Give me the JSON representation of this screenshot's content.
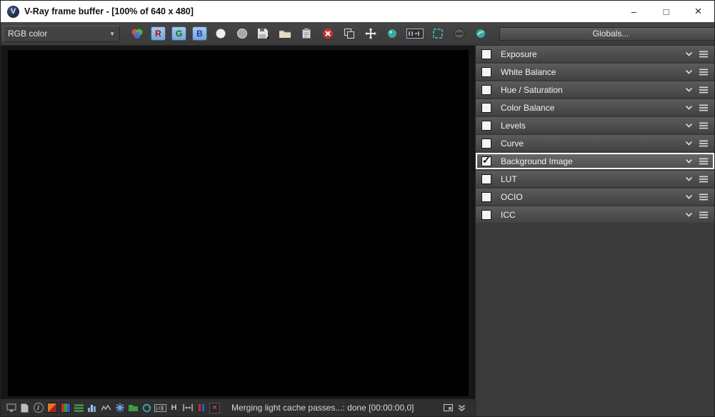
{
  "window": {
    "title": "V-Ray frame buffer - [100% of 640 x 480]",
    "logo_letter": "V",
    "controls": {
      "minimize": "–",
      "maximize": "□",
      "close": "×"
    }
  },
  "toolbar": {
    "channel_select_value": "RGB color",
    "channel_buttons": {
      "r": "R",
      "g": "G",
      "b": "B"
    },
    "globals_label": "Globals...",
    "icons": [
      "color-channels-icon",
      "red-channel-button",
      "green-channel-button",
      "blue-channel-button",
      "monochrome-channel-icon",
      "alpha-channel-icon",
      "save-image-icon",
      "load-image-icon",
      "copy-clipboard-icon",
      "clear-image-icon",
      "duplicate-window-icon",
      "track-mouse-icon",
      "render-last-icon",
      "stamp-icon",
      "region-render-icon",
      "stop-render-icon",
      "lens-effects-icon"
    ]
  },
  "panel": {
    "rows": [
      {
        "label": "Exposure",
        "checked": false,
        "highlighted": false
      },
      {
        "label": "White Balance",
        "checked": false,
        "highlighted": false
      },
      {
        "label": "Hue / Saturation",
        "checked": false,
        "highlighted": false
      },
      {
        "label": "Color Balance",
        "checked": false,
        "highlighted": false
      },
      {
        "label": "Levels",
        "checked": false,
        "highlighted": false
      },
      {
        "label": "Curve",
        "checked": false,
        "highlighted": false
      },
      {
        "label": "Background Image",
        "checked": true,
        "highlighted": true
      },
      {
        "label": "LUT",
        "checked": false,
        "highlighted": false
      },
      {
        "label": "OCIO",
        "checked": false,
        "highlighted": false
      },
      {
        "label": "ICC",
        "checked": false,
        "highlighted": false
      }
    ]
  },
  "statusbar": {
    "message": "Merging light cache passes...: done [00:00:00,0]",
    "icons": [
      "monitor-icon",
      "document-icon",
      "info-icon",
      "color-sample-icon",
      "rgb-pixels-icon",
      "list-icon",
      "histogram-icon",
      "waveform-icon",
      "asterisk-icon",
      "folder-icon",
      "refresh-icon",
      "lcd-icon",
      "letter-h-icon",
      "fit-width-icon",
      "compare-bars-icon",
      "close-stats-icon",
      "frame-outline-icon",
      "collapse-chevrons-icon"
    ]
  },
  "colors": {
    "channel_button_bg": "#7da7d9",
    "clear_red": "#c43333",
    "teal": "#3aa7a0",
    "highlight_border": "#ffffff"
  }
}
